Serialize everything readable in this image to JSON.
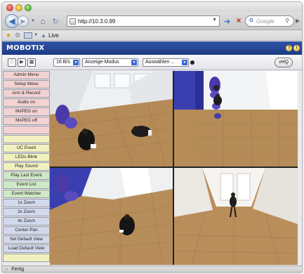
{
  "browser": {
    "url": "http://10.3.0.99",
    "search_placeholder": "Google",
    "bookmark_label": "Live",
    "status_text": "Fertig"
  },
  "app": {
    "brand": "MOBOTIX",
    "header_icons": [
      "help-icon",
      "info-icon"
    ],
    "view_buttons": [
      "single-view-icon",
      "play-icon",
      "quad-view-icon"
    ],
    "frame_rate": "16 B/s",
    "display_mode": "Anzeige-Modus",
    "select_placeholder": "Auswählen ...",
    "vhq_label": "vHQ"
  },
  "menu": {
    "items": [
      {
        "label": "Admin Menu",
        "color": "#f3d2d2"
      },
      {
        "label": "Setup Menu",
        "color": "#f3d2d2"
      },
      {
        "label": "Arm & Record",
        "color": "#f3d2d2"
      },
      {
        "label": "Audio on",
        "color": "#f3d2d2"
      },
      {
        "label": "MxPEG on",
        "color": "#f3d2d2"
      },
      {
        "label": "MxPEG off",
        "color": "#f3d2d2"
      },
      {
        "label": "",
        "color": "#f3d2d2"
      },
      {
        "label": "",
        "color": "#f1f1bf"
      },
      {
        "label": "UC Event",
        "color": "#f1f1bf"
      },
      {
        "label": "LEDs Blink",
        "color": "#f1f1bf"
      },
      {
        "label": "Play Sound",
        "color": "#f1f1bf"
      },
      {
        "label": "Play Last Event",
        "color": "#cfe8c5"
      },
      {
        "label": "Event List",
        "color": "#cfe8c5"
      },
      {
        "label": "Event Watcher",
        "color": "#cfe8c5"
      },
      {
        "label": "1x Zoom",
        "color": "#d3d9ec"
      },
      {
        "label": "2x Zoom",
        "color": "#d3d9ec"
      },
      {
        "label": "4x Zoom",
        "color": "#d3d9ec"
      },
      {
        "label": "Center Pan",
        "color": "#d3d9ec"
      },
      {
        "label": "Set Default View",
        "color": "#d3d9ec"
      },
      {
        "label": "Load Default View",
        "color": "#d3d9ec"
      },
      {
        "label": "",
        "color": "#f1f1bf"
      }
    ]
  },
  "cameras": [
    {
      "name": "camera-view-1"
    },
    {
      "name": "camera-view-2"
    },
    {
      "name": "camera-view-3"
    },
    {
      "name": "camera-view-4"
    }
  ]
}
